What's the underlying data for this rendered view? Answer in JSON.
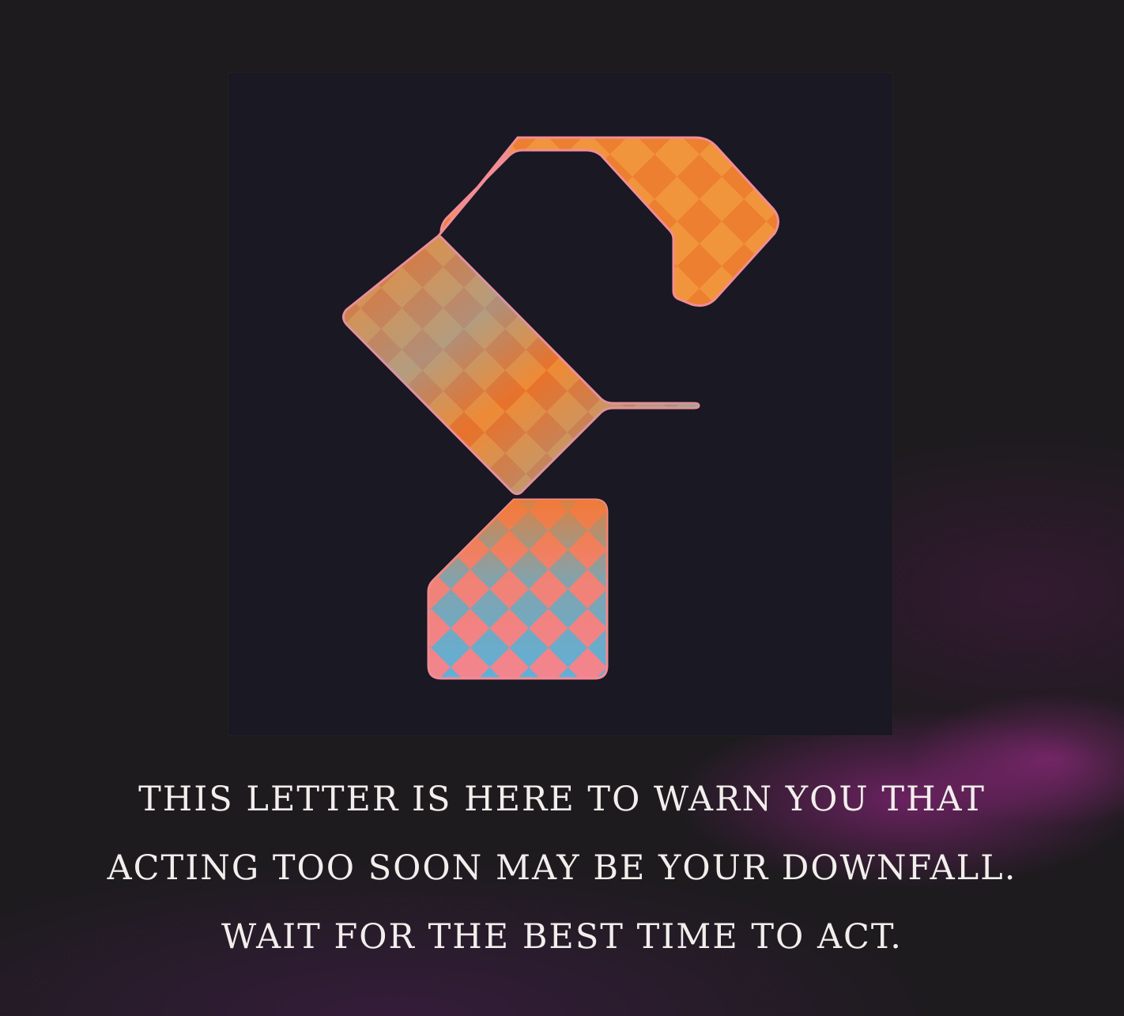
{
  "artwork": {
    "letter": "F",
    "colors": {
      "background": "#1e1b1f",
      "panel": "#1a1822",
      "orange": "#ec7a2c",
      "blue": "#5cafd6",
      "pink": "#f28a93",
      "caption": "#f2eeec"
    }
  },
  "caption": {
    "line1": "THIS LETTER IS HERE TO WARN YOU THAT",
    "line2": "ACTING TOO SOON MAY BE YOUR DOWNFALL.",
    "line3": "WAIT FOR THE BEST TIME TO ACT."
  }
}
